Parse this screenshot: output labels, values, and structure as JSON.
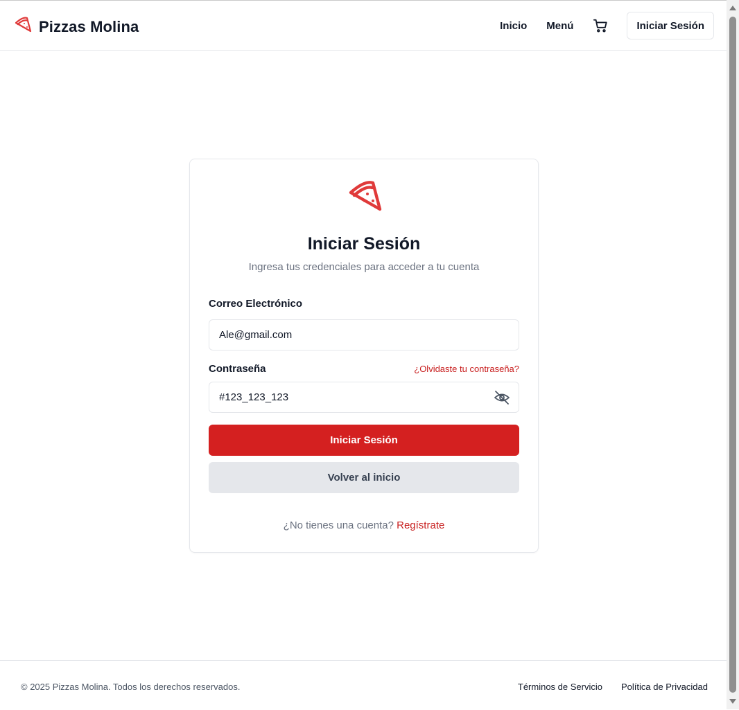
{
  "header": {
    "brand": "Pizzas Molina",
    "brand_icon": "pizza-slice-icon",
    "nav": {
      "home": "Inicio",
      "menu": "Menú"
    },
    "cart_icon": "shopping-cart-icon",
    "login_button": "Iniciar Sesión"
  },
  "login": {
    "logo_icon": "pizza-slice-icon",
    "title": "Iniciar Sesión",
    "subtitle": "Ingresa tus credenciales para acceder a tu cuenta",
    "email_label": "Correo Electrónico",
    "email_value": "Ale@gmail.com",
    "password_label": "Contraseña",
    "forgot_link": "¿Olvidaste tu contraseña?",
    "password_value": "#123_123_123",
    "toggle_icon": "eye-off-icon",
    "submit_button": "Iniciar Sesión",
    "back_button": "Volver al inicio",
    "signup_prompt": "¿No tienes una cuenta?",
    "signup_link": "Regístrate"
  },
  "footer": {
    "copyright": "© 2025 Pizzas Molina. Todos los derechos reservados.",
    "links": [
      "Términos de Servicio",
      "Política de Privacidad"
    ]
  },
  "colors": {
    "accent": "#d42020",
    "link": "#c81e1e",
    "muted": "#6b7280",
    "border": "#e5e7eb"
  }
}
